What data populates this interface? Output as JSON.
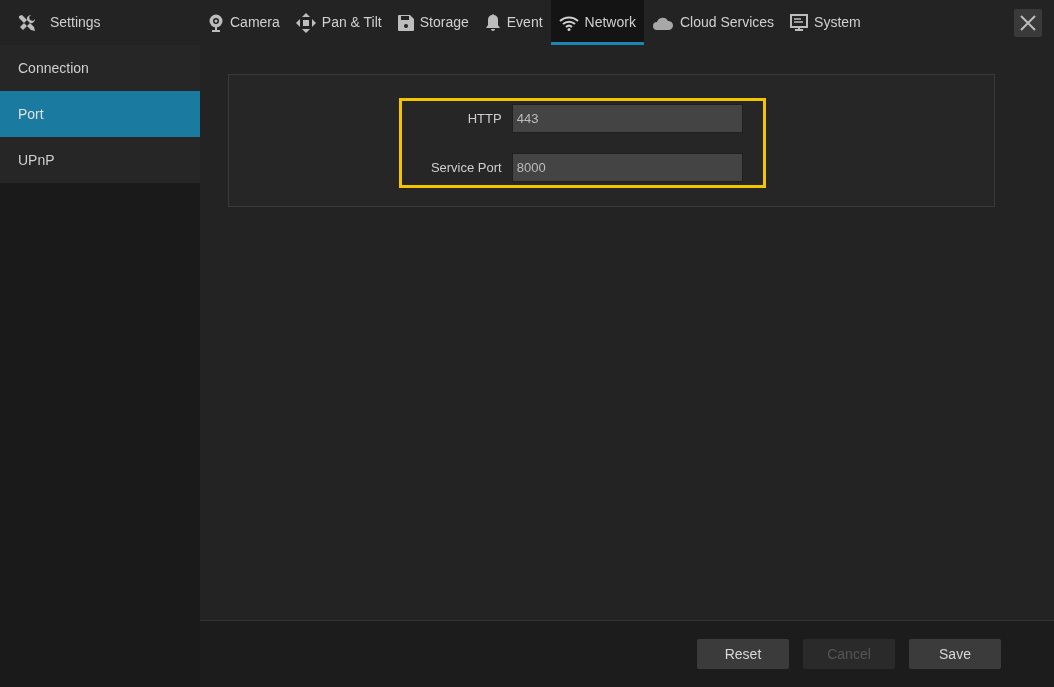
{
  "header": {
    "title": "Settings"
  },
  "tabs": [
    {
      "kind": "camera",
      "label": "Camera",
      "selected": false
    },
    {
      "kind": "pantilt",
      "label": "Pan & Tilt",
      "selected": false
    },
    {
      "kind": "storage",
      "label": "Storage",
      "selected": false
    },
    {
      "kind": "event",
      "label": "Event",
      "selected": false
    },
    {
      "kind": "network",
      "label": "Network",
      "selected": true
    },
    {
      "kind": "cloud",
      "label": "Cloud Services",
      "selected": false
    },
    {
      "kind": "system",
      "label": "System",
      "selected": false
    }
  ],
  "sidebar": {
    "items": [
      {
        "label": "Connection",
        "selected": false
      },
      {
        "label": "Port",
        "selected": true
      },
      {
        "label": "UPnP",
        "selected": false
      }
    ]
  },
  "form": {
    "highlighted": true,
    "fields": [
      {
        "label": "HTTP",
        "value": "443"
      },
      {
        "label": "Service Port",
        "value": "8000"
      }
    ]
  },
  "buttons": [
    {
      "label": "Reset",
      "disabled": false
    },
    {
      "label": "Cancel",
      "disabled": true
    },
    {
      "label": "Save",
      "disabled": false
    }
  ]
}
